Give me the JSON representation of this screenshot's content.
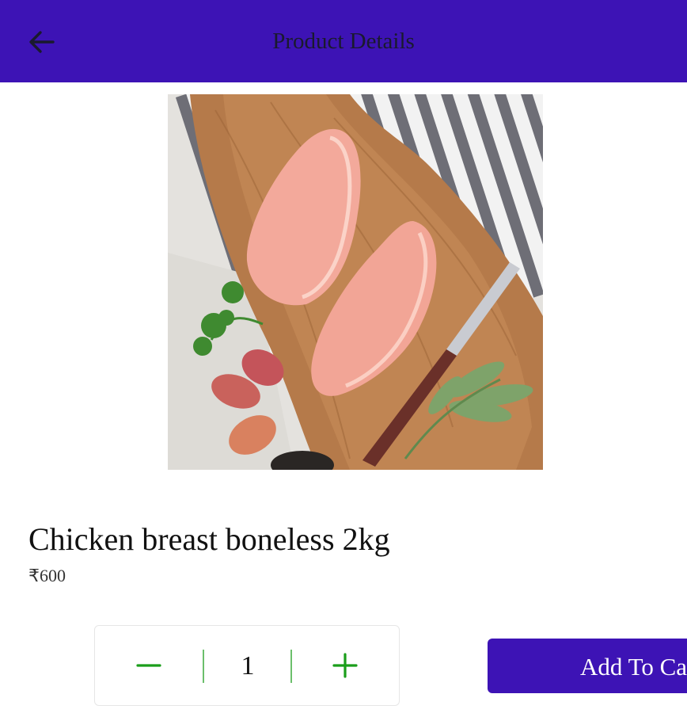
{
  "header": {
    "title": "Product Details",
    "back_icon": "arrow-left-icon",
    "background": "#3d13b5"
  },
  "product": {
    "name": "Chicken breast boneless 2kg",
    "price": "₹600",
    "image_alt": "Chicken breast boneless 2kg"
  },
  "quantity": {
    "value": "1",
    "decrement_icon": "minus-icon",
    "increment_icon": "plus-icon",
    "accent": "#1a9e1a"
  },
  "actions": {
    "add_to_cart": "Add To Cart"
  }
}
